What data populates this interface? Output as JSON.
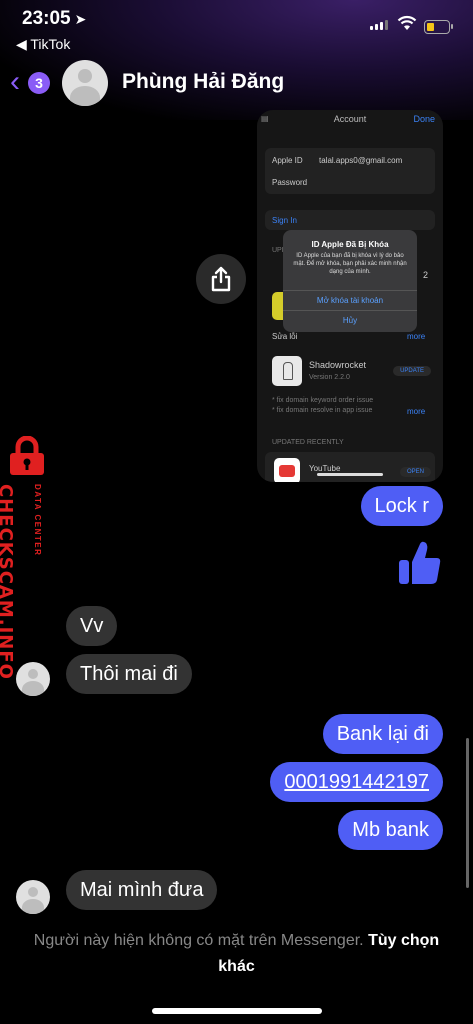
{
  "status_bar": {
    "time": "23:05",
    "back_app": "◀ TikTok"
  },
  "header": {
    "unread_count": "3",
    "contact_name": "Phùng Hải Đăng"
  },
  "shared_screenshot": {
    "nav_title": "Account",
    "nav_done": "Done",
    "apple_id_label": "Apple ID",
    "apple_id_value": "talal.apps0@gmail.com",
    "password_label": "Password",
    "sign_in": "Sign In",
    "updates_partial": "UPD",
    "update_count": "2",
    "fix_label": "Sửa lỗi",
    "more1": "more",
    "dialog_title": "ID Apple Đã Bị Khóa",
    "dialog_message": "ID Apple của bạn đã bị khóa vì lý do bảo mật. Để mở khóa, bạn phải xác minh nhận dạng của mình.",
    "dialog_unlock": "Mở khóa tài khoản",
    "dialog_cancel": "Hủy",
    "app_name": "Shadowrocket",
    "app_version": "Version 2.2.0",
    "update_btn": "UPDATE",
    "note1": "* fix domain keyword order issue",
    "note2": "* fix domain resolve in app issue",
    "more2": "more",
    "recent_header": "UPDATED RECENTLY",
    "recent_app": "YouTube",
    "open_btn": "OPEN"
  },
  "messages": [
    {
      "side": "out",
      "text": "Lock r"
    },
    {
      "side": "in",
      "text": "Vv"
    },
    {
      "side": "in",
      "text": "Thôi mai đi"
    },
    {
      "side": "out",
      "text": "Bank lại đi"
    },
    {
      "side": "out",
      "text": "0001991442197"
    },
    {
      "side": "out",
      "text": "Mb bank"
    },
    {
      "side": "in",
      "text": "Mai mình đưa"
    }
  ],
  "watermark": {
    "main": "CHECKSCAM.INFO",
    "sub": "DATA CENTER"
  },
  "footer": {
    "status_text": "Người này hiện không có mặt trên Messenger.",
    "options_link": "Tùy chọn khác"
  },
  "colors": {
    "accent": "#8a5cf6",
    "outgoing_bubble": "#4f5ef5",
    "incoming_bubble": "#333333",
    "watermark": "#e02020"
  }
}
